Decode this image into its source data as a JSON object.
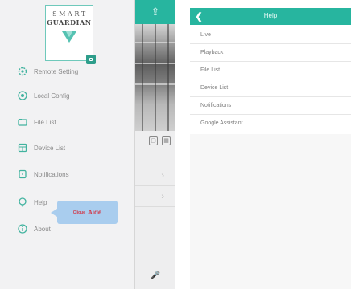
{
  "colors": {
    "accent": "#27b59f",
    "tooltip_bg": "#a9cdee",
    "tooltip_text": "#d13a4a"
  },
  "logo": {
    "line1": "SMART",
    "line2": "GUARDIAN"
  },
  "background_app": {
    "header_icon": "share-icon"
  },
  "menu": {
    "items": [
      {
        "label": "Remote Setting",
        "icon": "gear-icon"
      },
      {
        "label": "Local Config",
        "icon": "settings-icon"
      },
      {
        "label": "File List",
        "icon": "folder-icon"
      },
      {
        "label": "Device List",
        "icon": "camera-icon"
      },
      {
        "label": "Notifications",
        "icon": "bell-icon"
      },
      {
        "label": "Help",
        "icon": "help-icon"
      },
      {
        "label": "About",
        "icon": "info-icon"
      }
    ]
  },
  "tooltip": {
    "small": "Clique",
    "big": "Aide"
  },
  "help_screen": {
    "title": "Help",
    "items": [
      "Live",
      "Playback",
      "File List",
      "Device List",
      "Notifications",
      "Google Assistant"
    ]
  }
}
